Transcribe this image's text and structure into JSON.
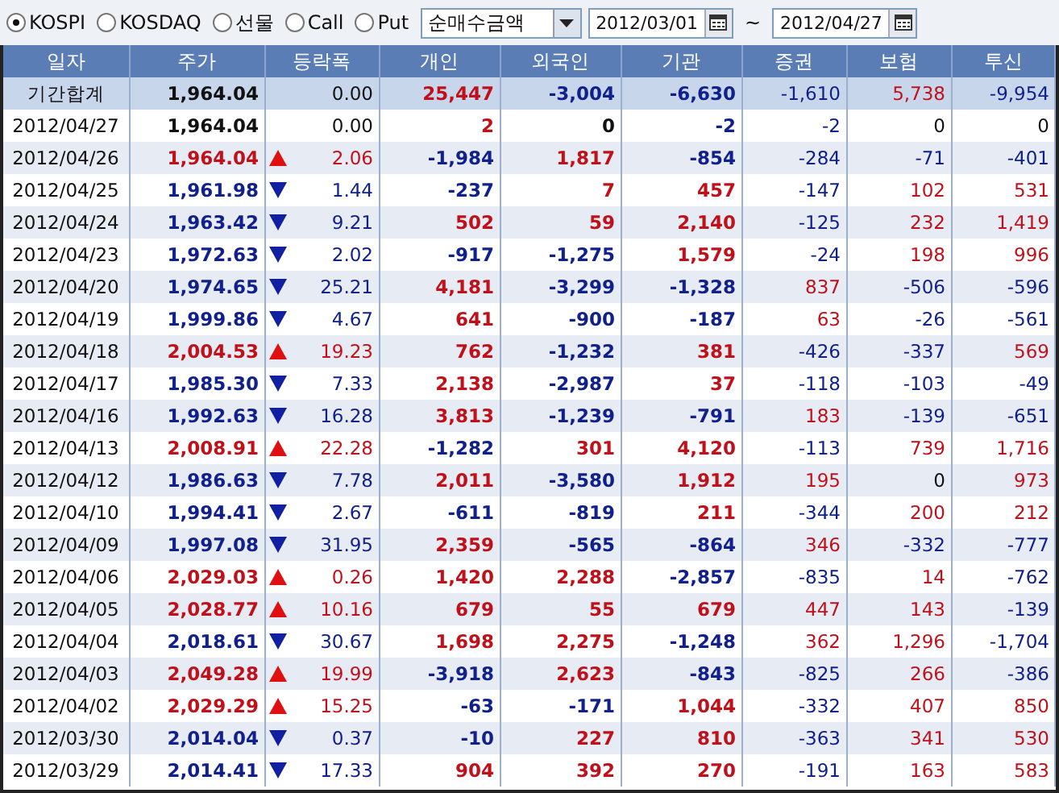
{
  "toolbar": {
    "markets": [
      {
        "label": "KOSPI",
        "selected": true
      },
      {
        "label": "KOSDAQ",
        "selected": false
      },
      {
        "label": "선물",
        "selected": false
      },
      {
        "label": "Call",
        "selected": false
      },
      {
        "label": "Put",
        "selected": false
      }
    ],
    "mode_select": {
      "value": "순매수금액"
    },
    "date_from": "2012/03/01",
    "range_sep": "~",
    "date_to": "2012/04/27"
  },
  "table": {
    "columns": [
      "일자",
      "주가",
      "등락폭",
      "개인",
      "외국인",
      "기관",
      "증권",
      "보험",
      "투신"
    ],
    "rows": [
      {
        "kind": "summary",
        "date": "기간합계",
        "price": "1,964.04",
        "up": false,
        "down": false,
        "change": "0.00",
        "individual": "25,447",
        "foreign": "-3,004",
        "institution": "-6,630",
        "securities": "-1,610",
        "insurance": "5,738",
        "trust": "-9,954"
      },
      {
        "kind": "day",
        "date": "2012/04/27",
        "price": "1,964.04",
        "up": false,
        "down": false,
        "change": "0.00",
        "individual": "2",
        "foreign": "0",
        "institution": "-2",
        "securities": "-2",
        "insurance": "0",
        "trust": "0"
      },
      {
        "kind": "day",
        "date": "2012/04/26",
        "price": "1,964.04",
        "up": true,
        "down": false,
        "change": "2.06",
        "individual": "-1,984",
        "foreign": "1,817",
        "institution": "-854",
        "securities": "-284",
        "insurance": "-71",
        "trust": "-401"
      },
      {
        "kind": "day",
        "date": "2012/04/25",
        "price": "1,961.98",
        "up": false,
        "down": true,
        "change": "1.44",
        "individual": "-237",
        "foreign": "7",
        "institution": "457",
        "securities": "-147",
        "insurance": "102",
        "trust": "531"
      },
      {
        "kind": "day",
        "date": "2012/04/24",
        "price": "1,963.42",
        "up": false,
        "down": true,
        "change": "9.21",
        "individual": "502",
        "foreign": "59",
        "institution": "2,140",
        "securities": "-125",
        "insurance": "232",
        "trust": "1,419"
      },
      {
        "kind": "day",
        "date": "2012/04/23",
        "price": "1,972.63",
        "up": false,
        "down": true,
        "change": "2.02",
        "individual": "-917",
        "foreign": "-1,275",
        "institution": "1,579",
        "securities": "-24",
        "insurance": "198",
        "trust": "996"
      },
      {
        "kind": "day",
        "date": "2012/04/20",
        "price": "1,974.65",
        "up": false,
        "down": true,
        "change": "25.21",
        "individual": "4,181",
        "foreign": "-3,299",
        "institution": "-1,328",
        "securities": "837",
        "insurance": "-506",
        "trust": "-596"
      },
      {
        "kind": "day",
        "date": "2012/04/19",
        "price": "1,999.86",
        "up": false,
        "down": true,
        "change": "4.67",
        "individual": "641",
        "foreign": "-900",
        "institution": "-187",
        "securities": "63",
        "insurance": "-26",
        "trust": "-561"
      },
      {
        "kind": "day",
        "date": "2012/04/18",
        "price": "2,004.53",
        "up": true,
        "down": false,
        "change": "19.23",
        "individual": "762",
        "foreign": "-1,232",
        "institution": "381",
        "securities": "-426",
        "insurance": "-337",
        "trust": "569"
      },
      {
        "kind": "day",
        "date": "2012/04/17",
        "price": "1,985.30",
        "up": false,
        "down": true,
        "change": "7.33",
        "individual": "2,138",
        "foreign": "-2,987",
        "institution": "37",
        "securities": "-118",
        "insurance": "-103",
        "trust": "-49"
      },
      {
        "kind": "day",
        "date": "2012/04/16",
        "price": "1,992.63",
        "up": false,
        "down": true,
        "change": "16.28",
        "individual": "3,813",
        "foreign": "-1,239",
        "institution": "-791",
        "securities": "183",
        "insurance": "-139",
        "trust": "-651"
      },
      {
        "kind": "day",
        "date": "2012/04/13",
        "price": "2,008.91",
        "up": true,
        "down": false,
        "change": "22.28",
        "individual": "-1,282",
        "foreign": "301",
        "institution": "4,120",
        "securities": "-113",
        "insurance": "739",
        "trust": "1,716"
      },
      {
        "kind": "day",
        "date": "2012/04/12",
        "price": "1,986.63",
        "up": false,
        "down": true,
        "change": "7.78",
        "individual": "2,011",
        "foreign": "-3,580",
        "institution": "1,912",
        "securities": "195",
        "insurance": "0",
        "trust": "973"
      },
      {
        "kind": "day",
        "date": "2012/04/10",
        "price": "1,994.41",
        "up": false,
        "down": true,
        "change": "2.67",
        "individual": "-611",
        "foreign": "-819",
        "institution": "211",
        "securities": "-344",
        "insurance": "200",
        "trust": "212"
      },
      {
        "kind": "day",
        "date": "2012/04/09",
        "price": "1,997.08",
        "up": false,
        "down": true,
        "change": "31.95",
        "individual": "2,359",
        "foreign": "-565",
        "institution": "-864",
        "securities": "346",
        "insurance": "-332",
        "trust": "-777"
      },
      {
        "kind": "day",
        "date": "2012/04/06",
        "price": "2,029.03",
        "up": true,
        "down": false,
        "change": "0.26",
        "individual": "1,420",
        "foreign": "2,288",
        "institution": "-2,857",
        "securities": "-835",
        "insurance": "14",
        "trust": "-762"
      },
      {
        "kind": "day",
        "date": "2012/04/05",
        "price": "2,028.77",
        "up": true,
        "down": false,
        "change": "10.16",
        "individual": "679",
        "foreign": "55",
        "institution": "679",
        "securities": "447",
        "insurance": "143",
        "trust": "-139"
      },
      {
        "kind": "day",
        "date": "2012/04/04",
        "price": "2,018.61",
        "up": false,
        "down": true,
        "change": "30.67",
        "individual": "1,698",
        "foreign": "2,275",
        "institution": "-1,248",
        "securities": "362",
        "insurance": "1,296",
        "trust": "-1,704"
      },
      {
        "kind": "day",
        "date": "2012/04/03",
        "price": "2,049.28",
        "up": true,
        "down": false,
        "change": "19.99",
        "individual": "-3,918",
        "foreign": "2,623",
        "institution": "-843",
        "securities": "-825",
        "insurance": "266",
        "trust": "-386"
      },
      {
        "kind": "day",
        "date": "2012/04/02",
        "price": "2,029.29",
        "up": true,
        "down": false,
        "change": "15.25",
        "individual": "-63",
        "foreign": "-171",
        "institution": "1,044",
        "securities": "-332",
        "insurance": "407",
        "trust": "850"
      },
      {
        "kind": "day",
        "date": "2012/03/30",
        "price": "2,014.04",
        "up": false,
        "down": true,
        "change": "0.37",
        "individual": "-10",
        "foreign": "227",
        "institution": "810",
        "securities": "-363",
        "insurance": "341",
        "trust": "530"
      },
      {
        "kind": "day",
        "date": "2012/03/29",
        "price": "2,014.41",
        "up": false,
        "down": true,
        "change": "17.33",
        "individual": "904",
        "foreign": "392",
        "institution": "270",
        "securities": "-191",
        "insurance": "163",
        "trust": "583"
      }
    ]
  }
}
